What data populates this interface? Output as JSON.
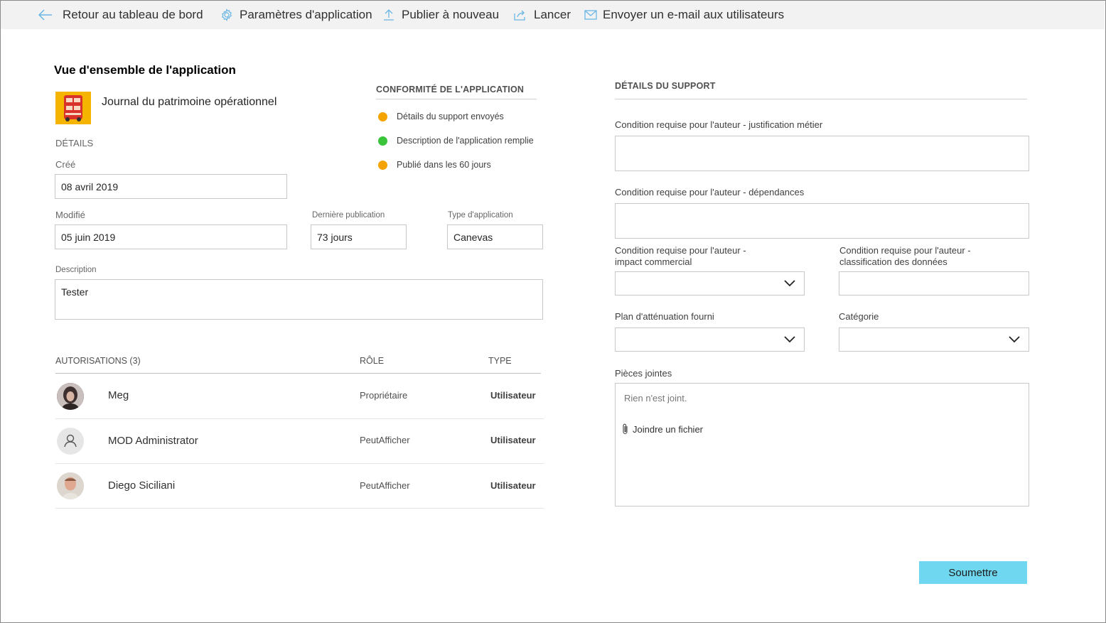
{
  "toolbar": {
    "back_label": "Retour au tableau de bord",
    "settings_label": "Paramètres d'application",
    "republish_label": "Publier à nouveau",
    "launch_label": "Lancer",
    "email_label": "Envoyer un e-mail aux utilisateurs"
  },
  "overview": {
    "title": "Vue d'ensemble de l'application",
    "app_name": "Journal du patrimoine opérationnel",
    "details_heading": "DÉTAILS",
    "created_label": "Créé",
    "created_value": "08 avril 2019",
    "modified_label": "Modifié",
    "modified_value": "05 juin 2019",
    "last_publish_label": "Dernière publication",
    "last_publish_value": "73 jours",
    "app_type_label": "Type d'application",
    "app_type_value": "Canevas",
    "description_label": "Description",
    "description_value": "Tester"
  },
  "compliance": {
    "heading": "CONFORMITÉ DE L'APPLICATION",
    "items": [
      {
        "label": "Détails du support envoyés",
        "color": "#f5a300"
      },
      {
        "label": "Description de l'application remplie",
        "color": "#3ac43a"
      },
      {
        "label": "Publié dans les 60 jours",
        "color": "#f5a300"
      }
    ]
  },
  "permissions": {
    "heading": "AUTORISATIONS (3)",
    "role_header": "RÔLE",
    "type_header": "TYPE",
    "rows": [
      {
        "name": "Meg",
        "role": "Propriétaire",
        "type": "Utilisateur"
      },
      {
        "name": "MOD Administrator",
        "role": "PeutAfficher",
        "type": "Utilisateur"
      },
      {
        "name": "Diego Siciliani",
        "role": "PeutAfficher",
        "type": "Utilisateur"
      }
    ]
  },
  "support": {
    "heading": "DÉTAILS DU SUPPORT",
    "justification_label": "Condition requise pour l'auteur - justification métier",
    "dependencies_label": "Condition requise pour l'auteur - dépendances",
    "impact_label_1": "Condition requise pour l'auteur -",
    "impact_label_2": "impact commercial",
    "classification_label_1": "Condition requise pour l'auteur -",
    "classification_label_2": "classification des données",
    "mitigation_label": "Plan d'atténuation fourni",
    "category_label": "Catégorie",
    "attachments_label": "Pièces jointes",
    "attachments_empty": "Rien n'est joint.",
    "attach_file_label": "Joindre un fichier",
    "submit_label": "Soumettre"
  },
  "colors": {
    "accent": "#70d7f0",
    "toolbar_icon": "#6ab6e3",
    "status_orange": "#f5a300",
    "status_green": "#3ac43a"
  }
}
